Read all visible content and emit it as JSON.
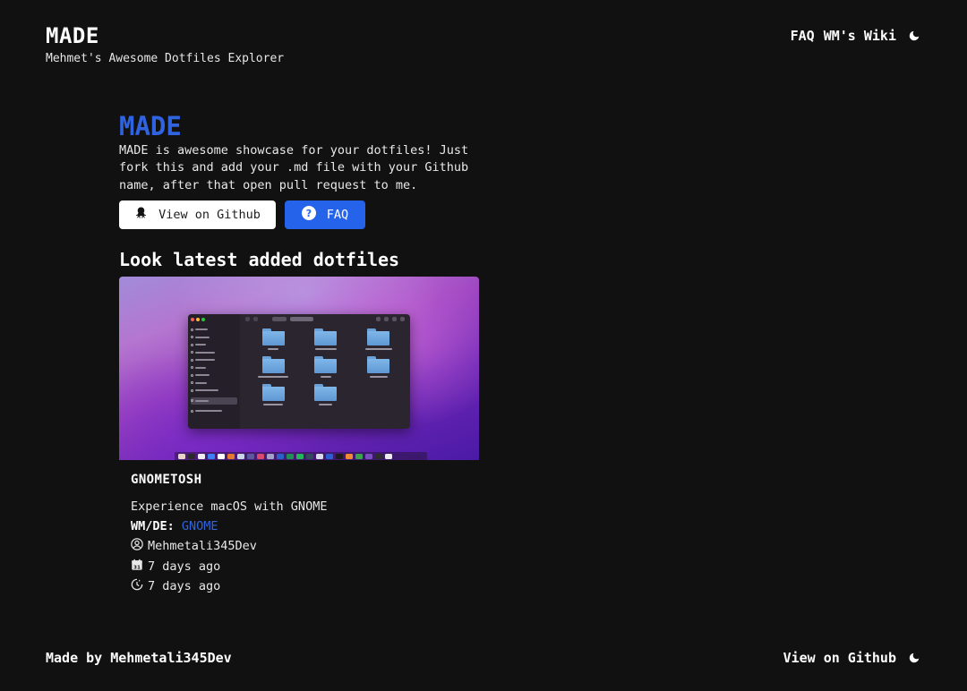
{
  "header": {
    "title": "MADE",
    "subtitle": "Mehmet's Awesome Dotfiles Explorer",
    "nav": {
      "faq": "FAQ",
      "wiki": "WM's Wiki"
    },
    "theme_icon": "moon-icon"
  },
  "hero": {
    "title": "MADE",
    "description": "MADE is awesome showcase for your dotfiles! Just fork this and add your .md file with your Github name, after that open pull request to me.",
    "github_button": "View on Github",
    "faq_button": "FAQ",
    "github_icon": "octocat-icon",
    "faq_icon": "question-circle-icon"
  },
  "latest": {
    "heading": "Look latest added dotfiles",
    "card": {
      "title": "GNOMETOSH",
      "description": "Experience macOS with GNOME",
      "wm_label": "WM/DE:",
      "wm_value": "GNOME",
      "author": "Mehmetali345Dev",
      "created": "7 days ago",
      "updated": "7 days ago",
      "icons": {
        "author": "user-circle-icon",
        "created": "calendar-icon",
        "updated": "clock-icon"
      }
    }
  },
  "footer": {
    "credit": "Made by Mehmetali345Dev",
    "github_link": "View on Github"
  },
  "colors": {
    "accent": "#2563eb",
    "background": "#111111",
    "text": "#ffffff"
  }
}
